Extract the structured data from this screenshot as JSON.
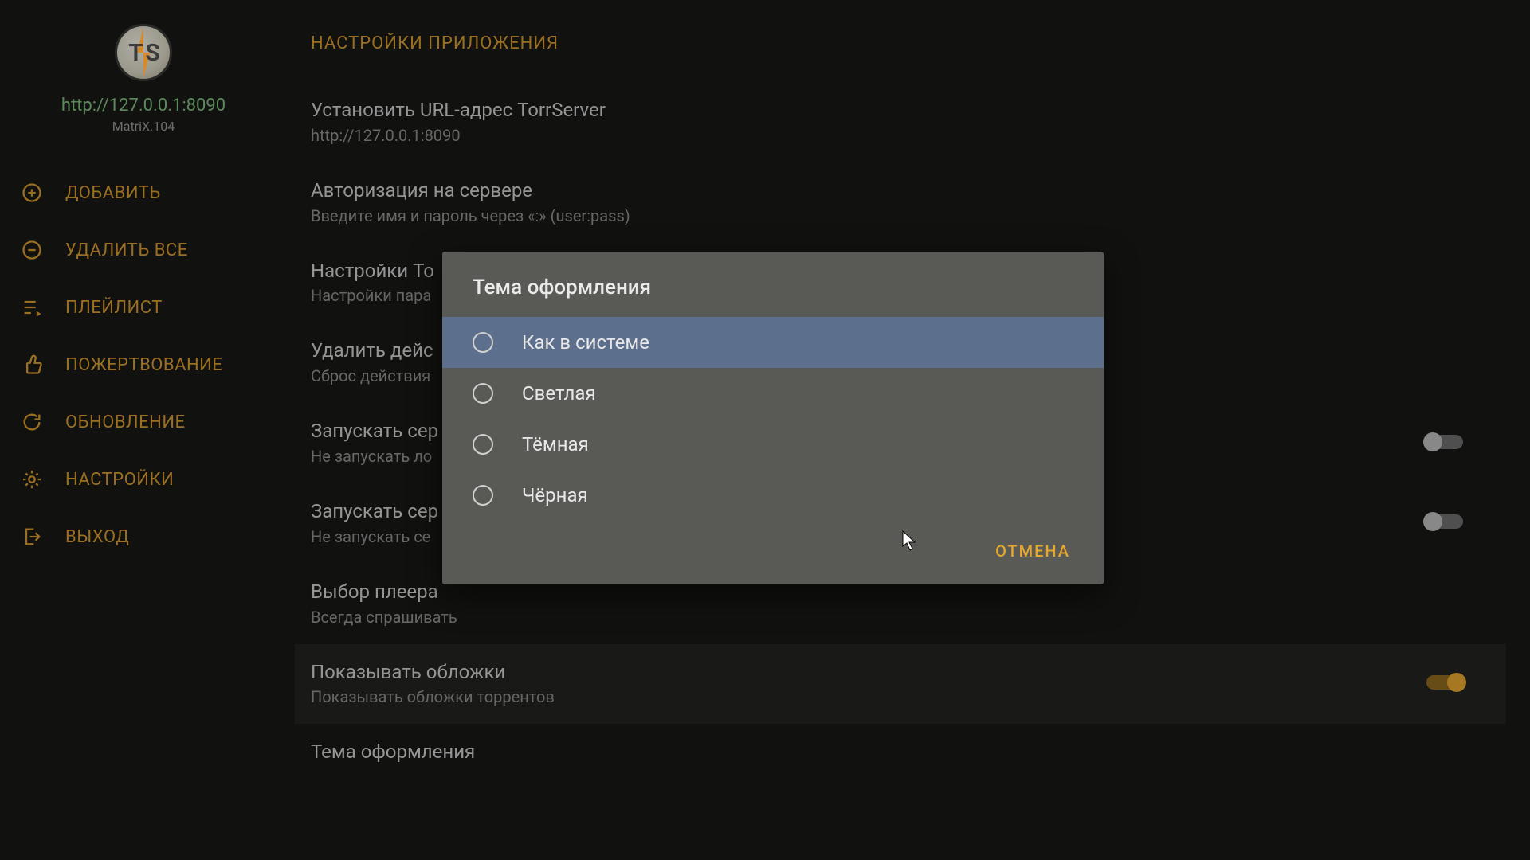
{
  "server": {
    "url": "http://127.0.0.1:8090",
    "version": "MatriX.104"
  },
  "sidebar": {
    "items": [
      {
        "label": "ДОБАВИТЬ"
      },
      {
        "label": "УДАЛИТЬ ВСЕ"
      },
      {
        "label": "ПЛЕЙЛИСТ"
      },
      {
        "label": "ПОЖЕРТВОВАНИЕ"
      },
      {
        "label": "ОБНОВЛЕНИЕ"
      },
      {
        "label": "НАСТРОЙКИ"
      },
      {
        "label": "ВЫХОД"
      }
    ]
  },
  "page": {
    "title": "НАСТРОЙКИ ПРИЛОЖЕНИЯ"
  },
  "settings": [
    {
      "title": "Установить URL-адрес TorrServer",
      "sub": "http://127.0.0.1:8090"
    },
    {
      "title": "Авторизация на сервере",
      "sub": "Введите имя и пароль через «:» (user:pass)"
    },
    {
      "title": "Настройки To",
      "sub": "Настройки пара"
    },
    {
      "title": "Удалить дейс",
      "sub": "Сброс действия"
    },
    {
      "title": "Запускать сер",
      "sub": "Не запускать ло",
      "toggle": false
    },
    {
      "title": "Запускать сер",
      "sub": "Не запускать се",
      "toggle": false
    },
    {
      "title": "Выбор плеера",
      "sub": "Всегда спрашивать"
    },
    {
      "title": "Показывать обложки",
      "sub": "Показывать обложки торрентов",
      "toggle": true,
      "highlight": true
    },
    {
      "title": "Тема оформления",
      "sub": ""
    }
  ],
  "dialog": {
    "title": "Тема оформления",
    "options": [
      {
        "label": "Как в системе",
        "active": true
      },
      {
        "label": "Светлая",
        "active": false
      },
      {
        "label": "Тёмная",
        "active": false
      },
      {
        "label": "Чёрная",
        "active": false
      }
    ],
    "cancel": "ОТМЕНА"
  }
}
